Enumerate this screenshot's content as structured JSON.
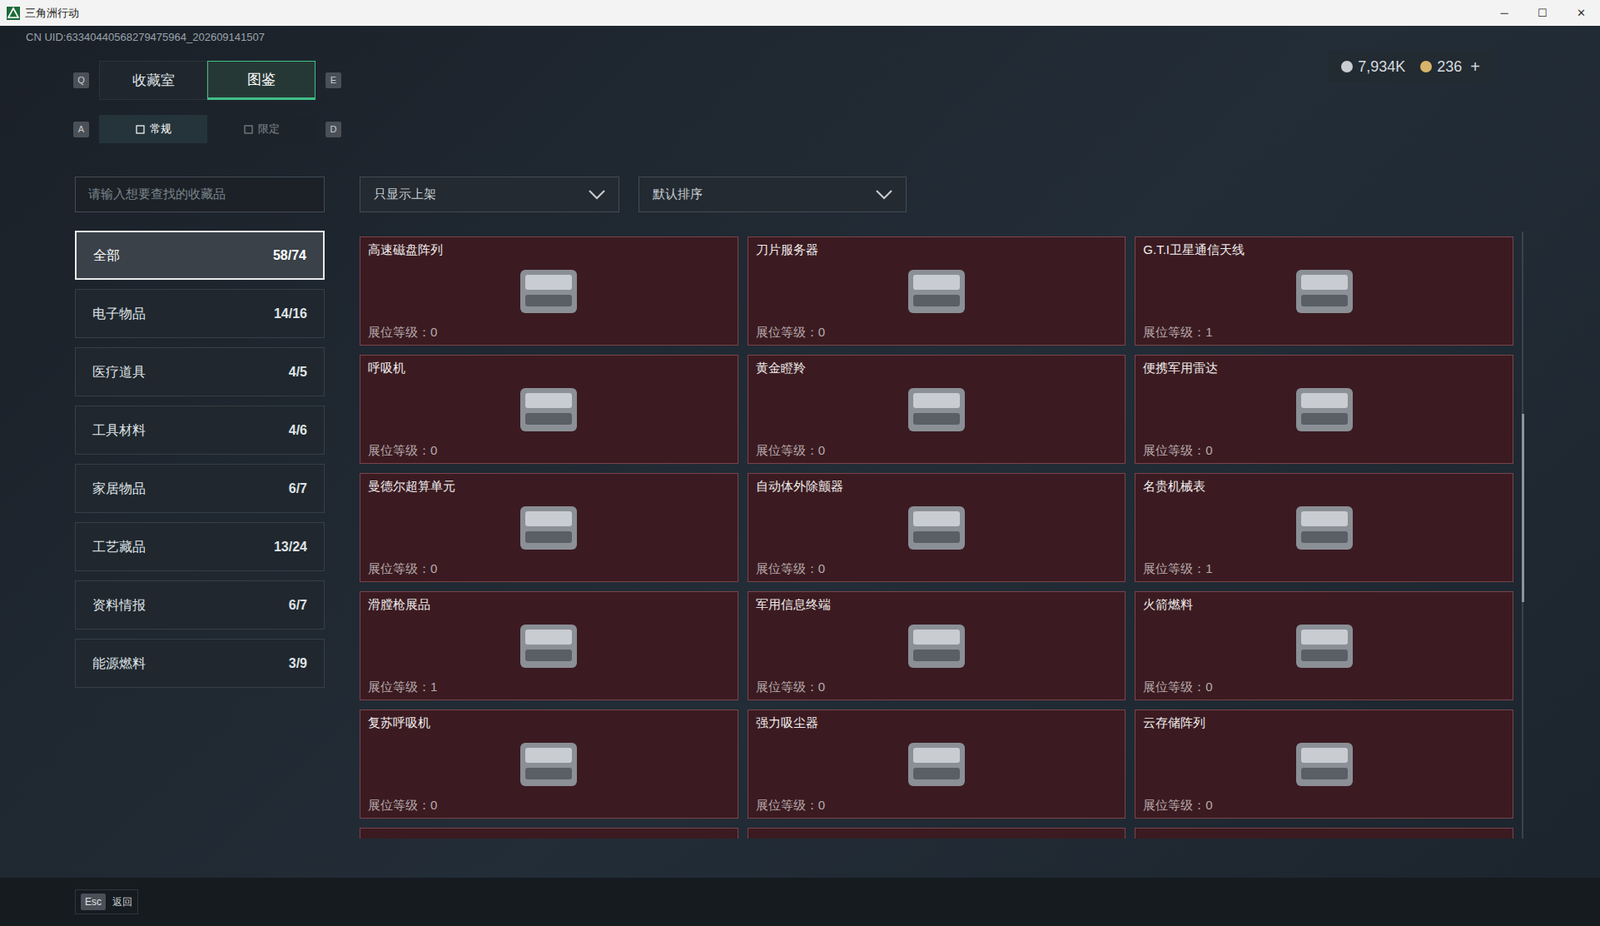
{
  "window": {
    "title": "三角洲行动",
    "controls": [
      "─",
      "☐",
      "✕"
    ]
  },
  "uid": "CN UID:6334044056827947596​4_202609141507",
  "currency": [
    {
      "amount": "7,934K",
      "color": "#c9cdd2"
    },
    {
      "amount": "236",
      "color": "#d8b46a"
    }
  ],
  "currency_add": "+",
  "tabs": {
    "prev_key": "Q",
    "next_key": "E",
    "items": [
      {
        "label": "收藏室",
        "selected": false
      },
      {
        "label": "图鉴",
        "selected": true
      }
    ]
  },
  "subtabs": {
    "prev_key": "A",
    "next_key": "D",
    "items": [
      {
        "label": "常规",
        "selected": true
      },
      {
        "label": "限定",
        "selected": false
      }
    ]
  },
  "search": {
    "placeholder": "请输入想要查找的收藏品"
  },
  "filters": [
    {
      "label": "只显示上架"
    },
    {
      "label": "默认排序"
    }
  ],
  "categories": [
    {
      "name": "全部",
      "count": "58/74",
      "selected": true
    },
    {
      "name": "电子物品",
      "count": "14/16",
      "selected": false
    },
    {
      "name": "医疗道具",
      "count": "4/5",
      "selected": false
    },
    {
      "name": "工具材料",
      "count": "4/6",
      "selected": false
    },
    {
      "name": "家居物品",
      "count": "6/7",
      "selected": false
    },
    {
      "name": "工艺藏品",
      "count": "13/24",
      "selected": false
    },
    {
      "name": "资料情报",
      "count": "6/7",
      "selected": false
    },
    {
      "name": "能源燃料",
      "count": "3/9",
      "selected": false
    }
  ],
  "level_label": "展位等级：",
  "items": [
    {
      "name": "高速磁盘阵列",
      "level": "0"
    },
    {
      "name": "刀片服务器",
      "level": "0"
    },
    {
      "name": "G.T.I卫星通信天线",
      "level": "1"
    },
    {
      "name": "呼吸机",
      "level": "0"
    },
    {
      "name": "黄金瞪羚",
      "level": "0"
    },
    {
      "name": "便携军用雷达",
      "level": "0"
    },
    {
      "name": "曼德尔超算单元",
      "level": "0"
    },
    {
      "name": "自动体外除颤器",
      "level": "0"
    },
    {
      "name": "名贵机械表",
      "level": "1"
    },
    {
      "name": "滑膛枪展品",
      "level": "1"
    },
    {
      "name": "军用信息终端",
      "level": "0"
    },
    {
      "name": "火箭燃料",
      "level": "0"
    },
    {
      "name": "复苏呼吸机",
      "level": "0"
    },
    {
      "name": "强力吸尘器",
      "level": "0"
    },
    {
      "name": "云存储阵列",
      "level": "0"
    }
  ],
  "partial_cards": 3,
  "scrollbar": {
    "position": 0.3,
    "size": 0.31
  },
  "footer": {
    "key": "Esc",
    "label": "返回"
  }
}
